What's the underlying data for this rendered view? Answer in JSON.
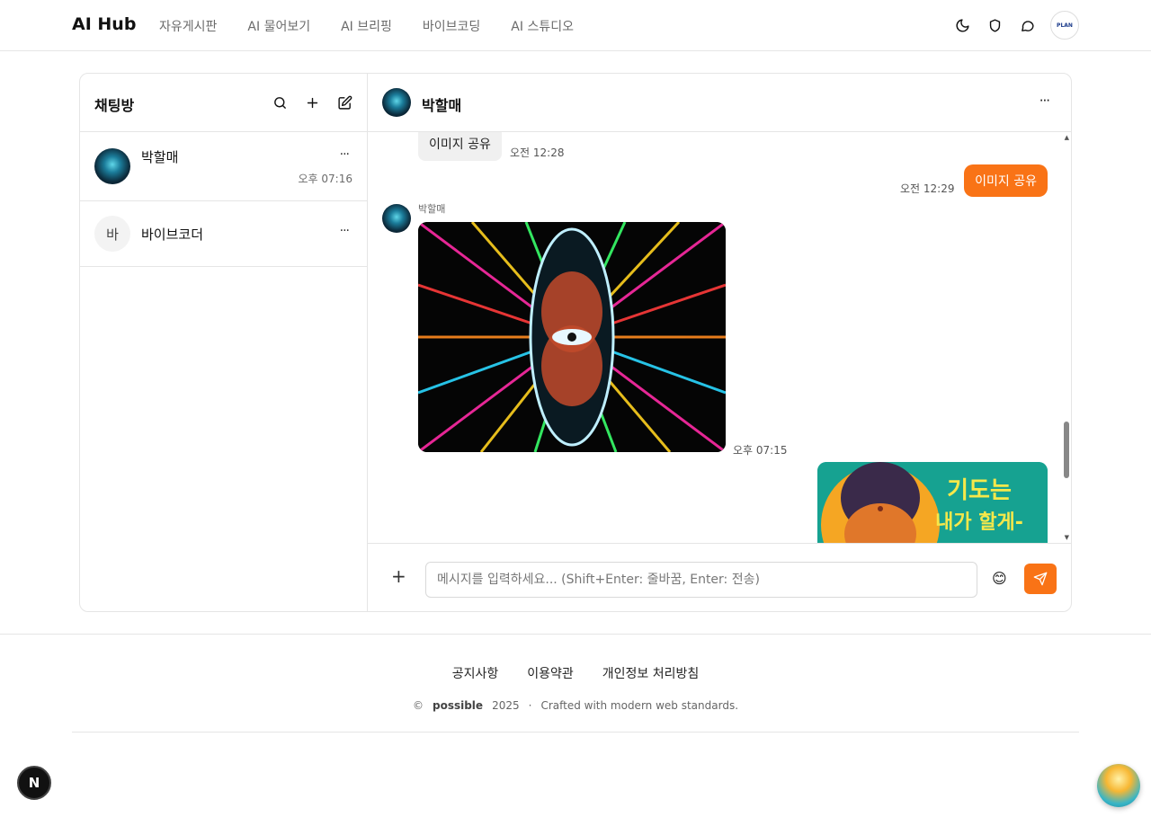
{
  "header": {
    "brand": "AI Hub",
    "nav": [
      "자유게시판",
      "AI 물어보기",
      "AI 브리핑",
      "바이브코딩",
      "AI 스튜디오"
    ],
    "icons": [
      "moon-icon",
      "shield-icon",
      "chat-bubble-icon"
    ],
    "profile_badge": "PLAN"
  },
  "sidebar": {
    "title": "채팅방",
    "rooms": [
      {
        "name": "박할매",
        "time": "오후 07:16",
        "more": "···"
      },
      {
        "name": "바이브코더",
        "avatar_text": "바",
        "more": "···"
      }
    ]
  },
  "chat": {
    "title": "박할매",
    "more": "···",
    "messages": [
      {
        "direction": "in",
        "text": "이미지 공유",
        "time": "오전 12:28"
      },
      {
        "direction": "out",
        "text": "이미지 공유",
        "time": "오전 12:29"
      },
      {
        "direction": "in",
        "sender": "박할매",
        "type": "image",
        "time": "오후 07:15"
      },
      {
        "direction": "out",
        "type": "image",
        "caption": "기도는 내가 할게-"
      }
    ],
    "composer": {
      "plus": "+",
      "placeholder": "메시지를 입력하세요... (Shift+Enter: 줄바꿈, Enter: 전송)",
      "emoji": "😊"
    }
  },
  "footer": {
    "links": [
      "공지사항",
      "이용약관",
      "개인정보 처리방침"
    ],
    "copyright_symbol": "©",
    "owner": "possible",
    "year": "2025",
    "separator": "·",
    "tagline": "Crafted with modern web standards."
  },
  "floating": {
    "n_badge": "N"
  },
  "colors": {
    "accent": "#f97316",
    "border": "#e5e5e5"
  }
}
